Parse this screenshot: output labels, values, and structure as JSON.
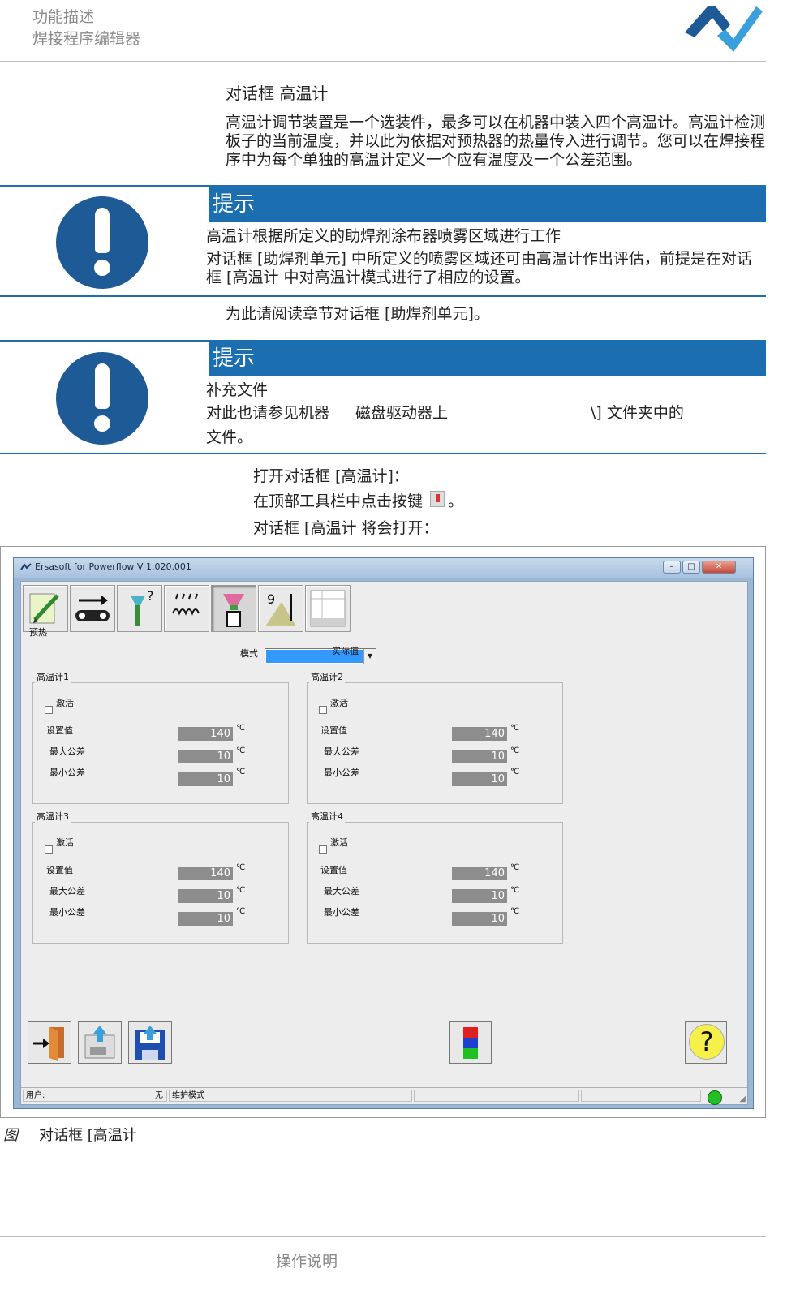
{
  "header": {
    "line1": "功能描述",
    "line2": "焊接程序编辑器",
    "logo_colors": [
      "#1e5b96",
      "#3aa0dc"
    ]
  },
  "section": {
    "title": "对话框  高温计",
    "paragraph": "高温计调节装置是一个选装件，最多可以在机器中装入四个高温计。高温计检测板子的当前温度，并以此为依据对预热器的热量传入进行调节。您可以在焊接程序中为每个单独的高温计定义一个应有温度及一个公差范围。"
  },
  "note1": {
    "title": "提示",
    "line1": "高温计根据所定义的助焊剂涂布器喷雾区域进行工作",
    "line2": "对话框 [助焊剂单元] 中所定义的喷雾区域还可由高温计作出评估，前提是在对话框 [高温计  中对高温计模式进行了相应的设置。"
  },
  "after_note1": "为此请阅读章节对话框 [助焊剂单元]。",
  "note2": {
    "title": "提示",
    "line1": "补充文件",
    "line2a": "对此也请参见机器",
    "line2b": "磁盘驱动器上",
    "line2c": "\\] 文件夹中的",
    "line3": "文件。"
  },
  "steps": {
    "line1": "打开对话框 [高温计]：",
    "line2a": "在顶部工具栏中点击按键",
    "line2b": "。",
    "line3": "对话框 [高温计  将会打开："
  },
  "app": {
    "title": "Ersasoft for Powerflow V 1.020.001",
    "tab_label": "预热",
    "mode_label": "模式",
    "mode_value": "实际值",
    "pyrometers": [
      {
        "name": "高温计1",
        "active_label": "激活",
        "set_label": "设置值",
        "max_label": "最大公差",
        "min_label": "最小公差",
        "set": "140",
        "max": "10",
        "min": "10",
        "unit": "℃"
      },
      {
        "name": "高温计2",
        "active_label": "激活",
        "set_label": "设置值",
        "max_label": "最大公差",
        "min_label": "最小公差",
        "set": "140",
        "max": "10",
        "min": "10",
        "unit": "℃"
      },
      {
        "name": "高温计3",
        "active_label": "激活",
        "set_label": "设置值",
        "max_label": "最大公差",
        "min_label": "最小公差",
        "set": "140",
        "max": "10",
        "min": "10",
        "unit": "℃"
      },
      {
        "name": "高温计4",
        "active_label": "激活",
        "set_label": "设置值",
        "max_label": "最大公差",
        "min_label": "最小公差",
        "set": "140",
        "max": "10",
        "min": "10",
        "unit": "℃"
      }
    ],
    "help_glyph": "?",
    "status": {
      "user_label": "用户:",
      "user_value": "无",
      "mode": "维护模式"
    }
  },
  "caption": {
    "prefix": "图",
    "text": "对话框 [高温计"
  },
  "footer": "操作说明"
}
